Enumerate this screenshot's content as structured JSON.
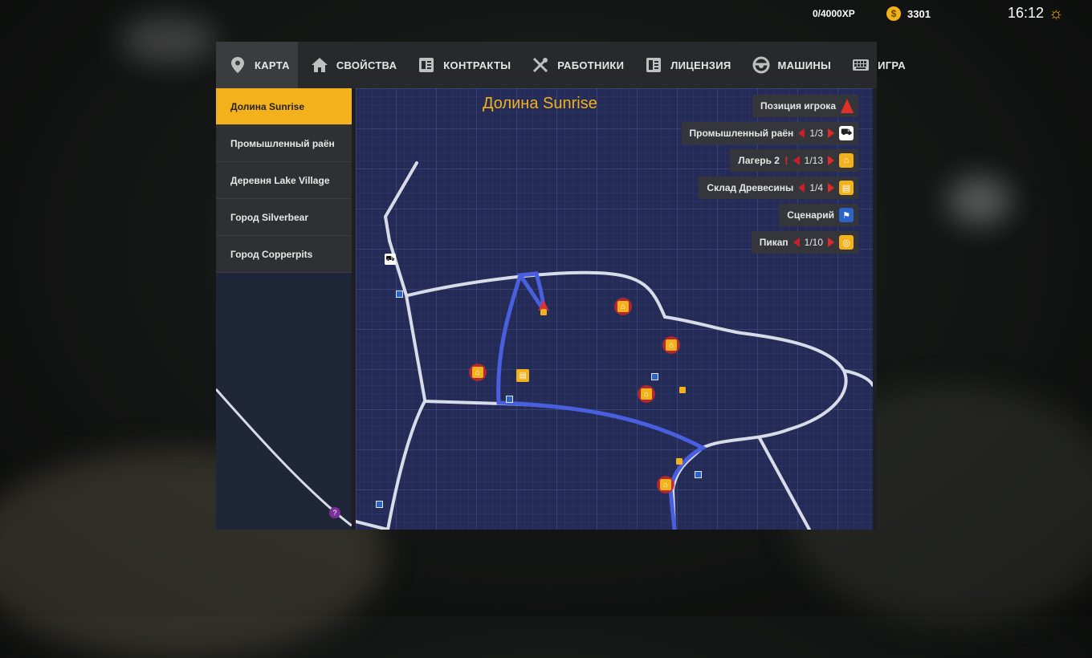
{
  "hud": {
    "xp": "0/4000XP",
    "money": "3301",
    "time": "16:12",
    "coin_icon": "$"
  },
  "tabs": [
    {
      "label": "КАРТА",
      "icon": "map-pin-icon",
      "active": true
    },
    {
      "label": "СВОЙСТВА",
      "icon": "home-icon"
    },
    {
      "label": "КОНТРАКТЫ",
      "icon": "document-icon"
    },
    {
      "label": "РАБОТНИКИ",
      "icon": "tools-icon"
    },
    {
      "label": "ЛИЦЕНЗИЯ",
      "icon": "license-icon"
    },
    {
      "label": "МАШИНЫ",
      "icon": "steering-wheel-icon"
    },
    {
      "label": "ИГРА",
      "icon": "keyboard-icon"
    }
  ],
  "regions": [
    {
      "label": "Долина Sunrise",
      "active": true
    },
    {
      "label": "Промышленный раён"
    },
    {
      "label": "Деревня Lake Village"
    },
    {
      "label": "Город Silverbear"
    },
    {
      "label": "Город Copperpits"
    }
  ],
  "map": {
    "title": "Долина Sunrise",
    "legend": {
      "player": "Позиция игрока",
      "industrial": {
        "label": "Промышленный раён",
        "count": "1/3"
      },
      "camp": {
        "label": "Лагерь 2",
        "count": "1/13",
        "alert": "!"
      },
      "warehouse": {
        "label": "Склад Древесины",
        "count": "1/4"
      },
      "scenario": {
        "label": "Сценарий"
      },
      "pickup": {
        "label": "Пикап",
        "count": "1/10"
      }
    }
  },
  "colors": {
    "accent": "#f3b21b",
    "road": "#d8dce8",
    "route": "#4a5ee0",
    "map_bg": "#232b56"
  }
}
